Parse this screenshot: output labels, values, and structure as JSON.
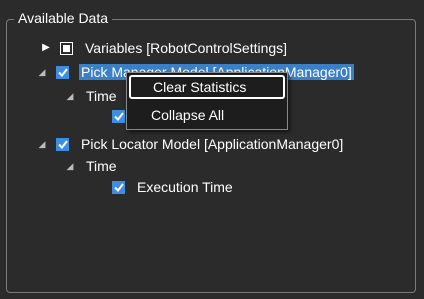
{
  "group": {
    "title": "Available Data"
  },
  "tree": {
    "variables": {
      "label": "Variables [RobotControlSettings]"
    },
    "pick_manager": {
      "label": "Pick Manager Model [ApplicationManager0]"
    },
    "pick_manager_time": {
      "label": "Time"
    },
    "pick_locator": {
      "label": "Pick Locator Model [ApplicationManager0]"
    },
    "pick_locator_time": {
      "label": "Time"
    },
    "execution_time": {
      "label": "Execution Time"
    }
  },
  "context_menu": {
    "items": [
      "Clear Statistics",
      "Collapse All"
    ]
  },
  "colors": {
    "background": "#2b2b2b",
    "selection": "#3b7fc7",
    "checkbox": "#3e8de0"
  }
}
